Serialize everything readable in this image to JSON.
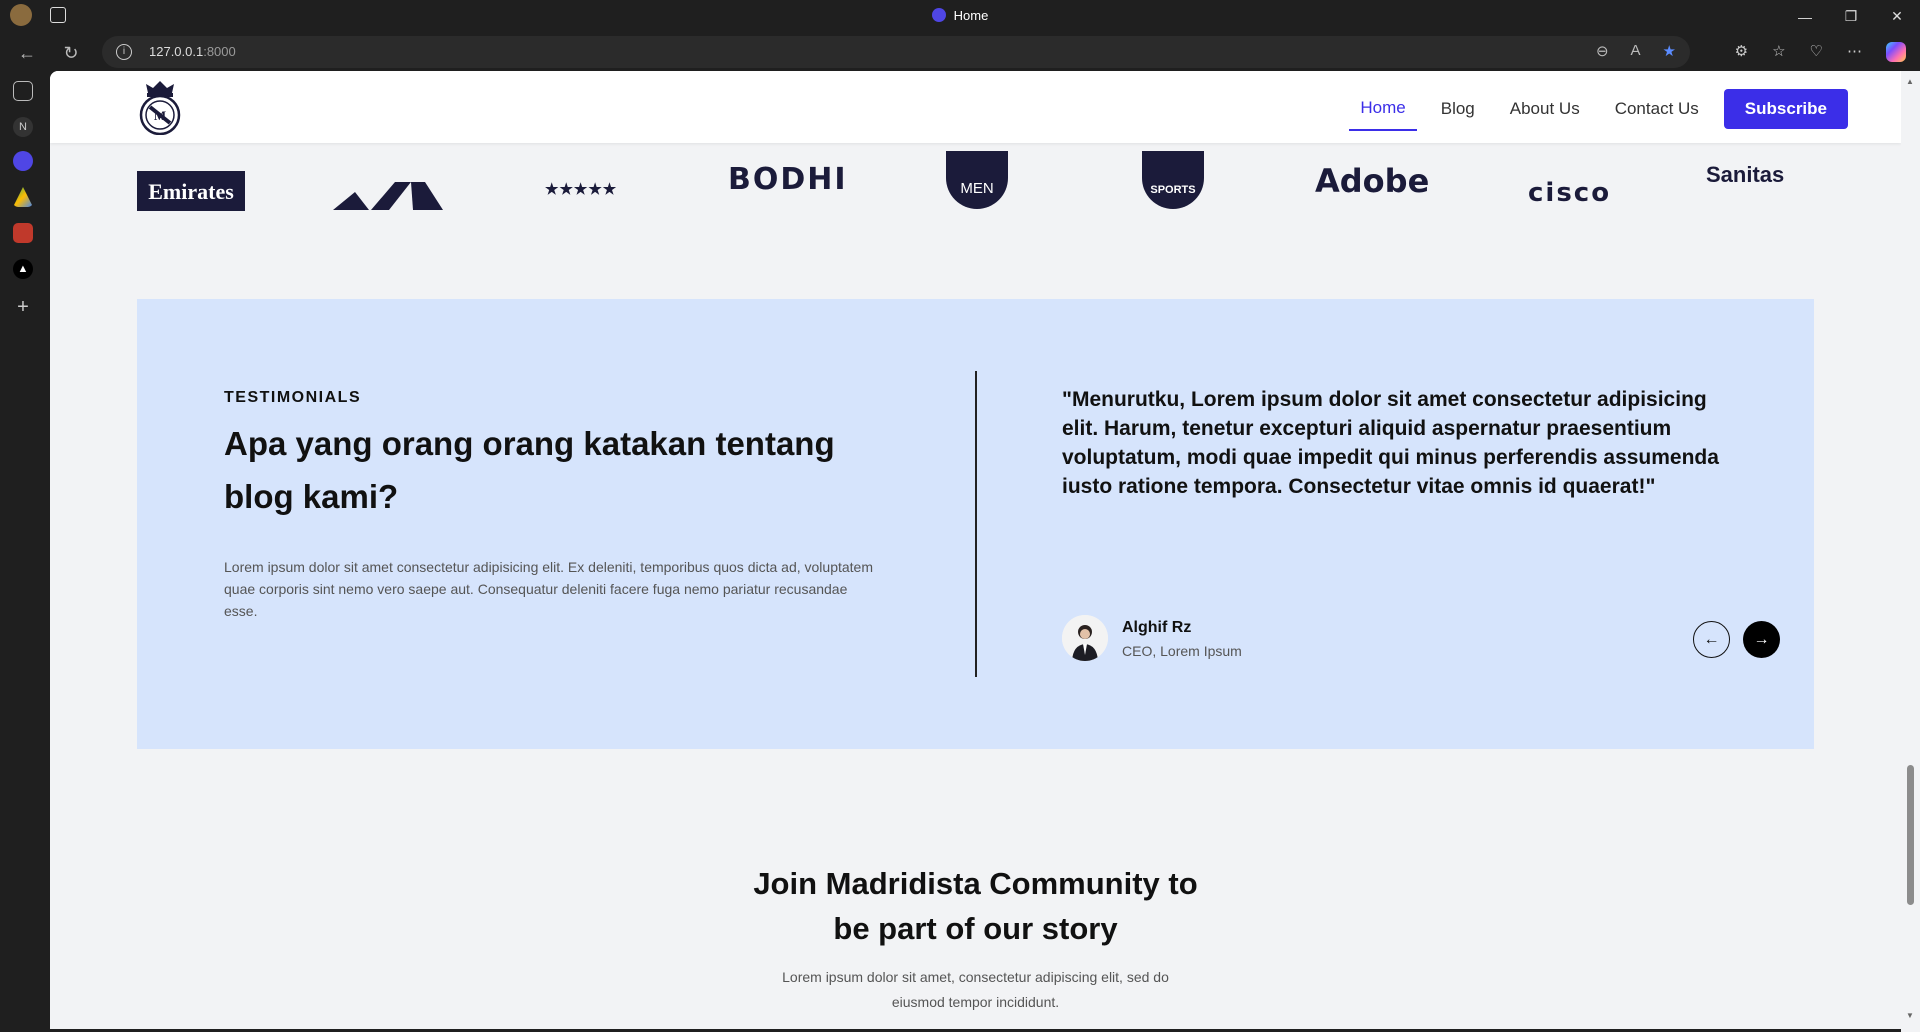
{
  "browser": {
    "tab_title": "Home",
    "url_host": "127.0.0.1",
    "url_port": ":8000"
  },
  "nav": {
    "links": [
      "Home",
      "Blog",
      "About Us",
      "Contact Us"
    ],
    "subscribe": "Subscribe"
  },
  "logos": {
    "emirates": "Emirates",
    "stars": "★★★★★",
    "bodhi": "BODHI",
    "men": "MEN",
    "sports": "SPORTS",
    "adobe": "Adobe",
    "cisco": "cisco",
    "sanitas": "Sanitas"
  },
  "testimonials": {
    "eyebrow": "TESTIMONIALS",
    "heading": "Apa yang orang orang katakan tentang blog kami?",
    "lead": "Lorem ipsum dolor sit amet consectetur adipisicing elit. Ex deleniti, temporibus quos dicta ad, voluptatem quae corporis sint nemo vero saepe aut. Consequatur deleniti facere fuga nemo pariatur recusandae esse.",
    "quote": "\"Menurutku, Lorem ipsum dolor sit amet consectetur adipisicing elit. Harum, tenetur excepturi aliquid aspernatur praesentium voluptatum, modi quae impedit qui minus perferendis assumenda iusto ratione tempora. Consectetur vitae omnis id quaerat!\"",
    "author": "Alghif Rz",
    "role": "CEO, Lorem Ipsum"
  },
  "join": {
    "heading_line1": "Join Madridista Community to",
    "heading_line2": "be part of our story",
    "text_line1": "Lorem ipsum dolor sit amet, consectetur adipiscing elit, sed do",
    "text_line2": "eiusmod tempor incididunt."
  },
  "colors": {
    "accent": "#3b2ee8",
    "testimonial_bg": "#d6e4fc",
    "page_bg": "#f2f3f5"
  }
}
